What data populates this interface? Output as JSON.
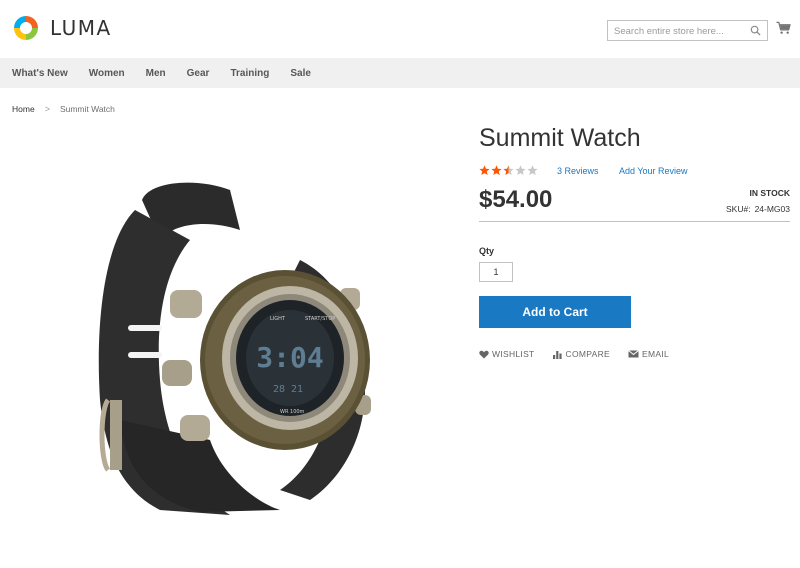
{
  "header": {
    "logo_text": "LUMA",
    "search_placeholder": "Search entire store here..."
  },
  "nav": {
    "items": [
      {
        "label": "What's New"
      },
      {
        "label": "Women"
      },
      {
        "label": "Men"
      },
      {
        "label": "Gear"
      },
      {
        "label": "Training"
      },
      {
        "label": "Sale"
      }
    ]
  },
  "breadcrumb": {
    "home": "Home",
    "separator": ">",
    "current": "Summit Watch"
  },
  "product": {
    "name": "Summit Watch",
    "rating_stars": 2.5,
    "rating_max": 5,
    "reviews_label": "3 Reviews",
    "add_review_label": "Add Your Review",
    "price": "$54.00",
    "stock": "IN STOCK",
    "sku_label": "SKU#:",
    "sku": "24-MG03",
    "qty_label": "Qty",
    "qty_value": "1",
    "add_to_cart_label": "Add to Cart"
  },
  "actions": {
    "wishlist": "WISHLIST",
    "compare": "COMPARE",
    "email": "EMAIL"
  },
  "colors": {
    "accent": "#1979c3",
    "star_filled": "#ff5501",
    "star_empty": "#c7c7c7",
    "nav_bg": "#f0f0f0"
  }
}
